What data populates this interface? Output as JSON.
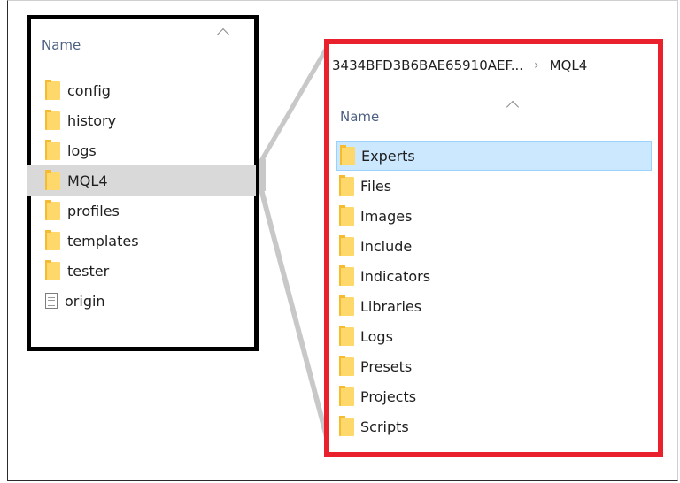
{
  "left_panel": {
    "header": "Name",
    "items": [
      {
        "label": "config",
        "icon": "folder-icon"
      },
      {
        "label": "history",
        "icon": "folder-icon"
      },
      {
        "label": "logs",
        "icon": "folder-icon"
      },
      {
        "label": "MQL4",
        "icon": "folder-icon",
        "selected": true
      },
      {
        "label": "profiles",
        "icon": "folder-icon"
      },
      {
        "label": "templates",
        "icon": "folder-icon"
      },
      {
        "label": "tester",
        "icon": "folder-icon"
      },
      {
        "label": "origin",
        "icon": "file-icon"
      }
    ]
  },
  "right_panel": {
    "breadcrumb": [
      "3434BFD3B6BAE65910AEF...",
      "MQL4"
    ],
    "breadcrumb_separator": "›",
    "header": "Name",
    "items": [
      {
        "label": "Experts",
        "selected": true
      },
      {
        "label": "Files"
      },
      {
        "label": "Images"
      },
      {
        "label": "Include"
      },
      {
        "label": "Indicators"
      },
      {
        "label": "Libraries"
      },
      {
        "label": "Logs"
      },
      {
        "label": "Presets"
      },
      {
        "label": "Projects"
      },
      {
        "label": "Scripts"
      }
    ]
  },
  "colors": {
    "left_border": "#000000",
    "right_border": "#e8212d",
    "selection_left": "#d9d9d9",
    "selection_right": "#cce8ff",
    "connector": "#c8c8c8",
    "header_text": "#4d6082"
  }
}
